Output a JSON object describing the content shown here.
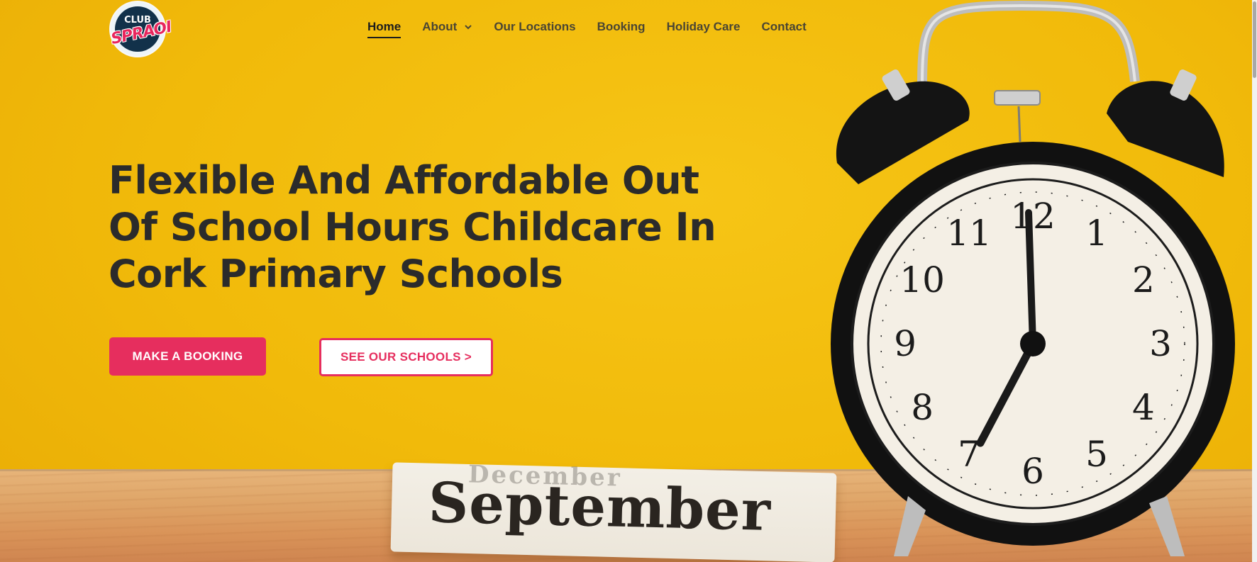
{
  "logo": {
    "top_text": "CLUB",
    "main_text": "SPRAOI"
  },
  "nav": {
    "items": [
      {
        "label": "Home",
        "active": true
      },
      {
        "label": "About",
        "dropdown": true
      },
      {
        "label": "Our Locations"
      },
      {
        "label": "Booking"
      },
      {
        "label": "Holiday Care"
      },
      {
        "label": "Contact"
      }
    ]
  },
  "hero": {
    "headline": "Flexible And Affordable Out Of School Hours Childcare In Cork Primary Schools",
    "primary_button": "MAKE A BOOKING",
    "secondary_button": "SEE OUR SCHOOLS >",
    "block_text": "September",
    "block_top_text": "December",
    "clock_numbers": [
      "12",
      "1",
      "2",
      "3",
      "4",
      "5",
      "6",
      "7",
      "8",
      "9",
      "10",
      "11"
    ]
  },
  "colors": {
    "background": "#f2bb0c",
    "accent": "#e62e5e",
    "text_dark": "#2b2b2b",
    "nav_text": "#4a4533"
  },
  "icons": {
    "dropdown": "chevron-down-icon"
  }
}
